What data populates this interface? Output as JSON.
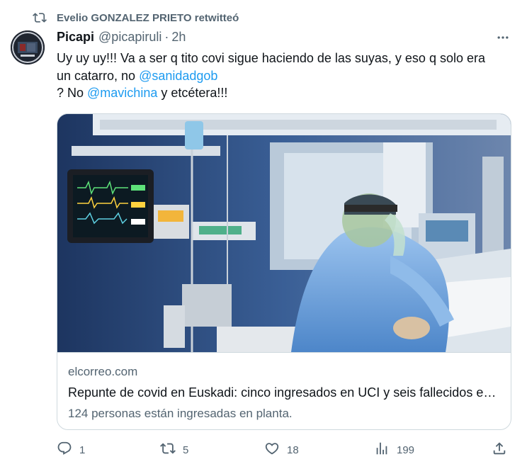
{
  "retweet": {
    "icon": "retweet-icon",
    "text": "Evelio GONZALEZ PRIETO retwitteó"
  },
  "author": {
    "name": "Picapi",
    "handle": "@picapiruli",
    "separator": "·",
    "time": "2h",
    "avatar_icon": "avatar"
  },
  "more_icon": "more-options-icon",
  "tweet": {
    "line1": "Uy uy uy!!! Va a ser q tito covi sigue haciendo de las suyas, y eso q solo era",
    "line2_prefix": "un catarro, no ",
    "mention1": "@sanidadgob",
    "line3_prefix": "? No ",
    "mention2": "@mavichina",
    "line3_suffix": " y etcétera!!!"
  },
  "card": {
    "image_icon": "icu-photo",
    "domain": "elcorreo.com",
    "title": "Repunte de covid en Euskadi: cinco ingresados en UCI y seis fallecidos en una semana",
    "description": "124 personas están ingresadas en planta."
  },
  "actions": {
    "reply": {
      "icon": "reply-icon",
      "count": "1"
    },
    "retweet": {
      "icon": "retweet-icon",
      "count": "5"
    },
    "like": {
      "icon": "heart-icon",
      "count": "18"
    },
    "views": {
      "icon": "views-icon",
      "count": "199"
    },
    "share": {
      "icon": "share-icon"
    }
  },
  "colors": {
    "text": "#0f1419",
    "secondary": "#536471",
    "link": "#1d9bf0",
    "border": "#cfd9de"
  }
}
